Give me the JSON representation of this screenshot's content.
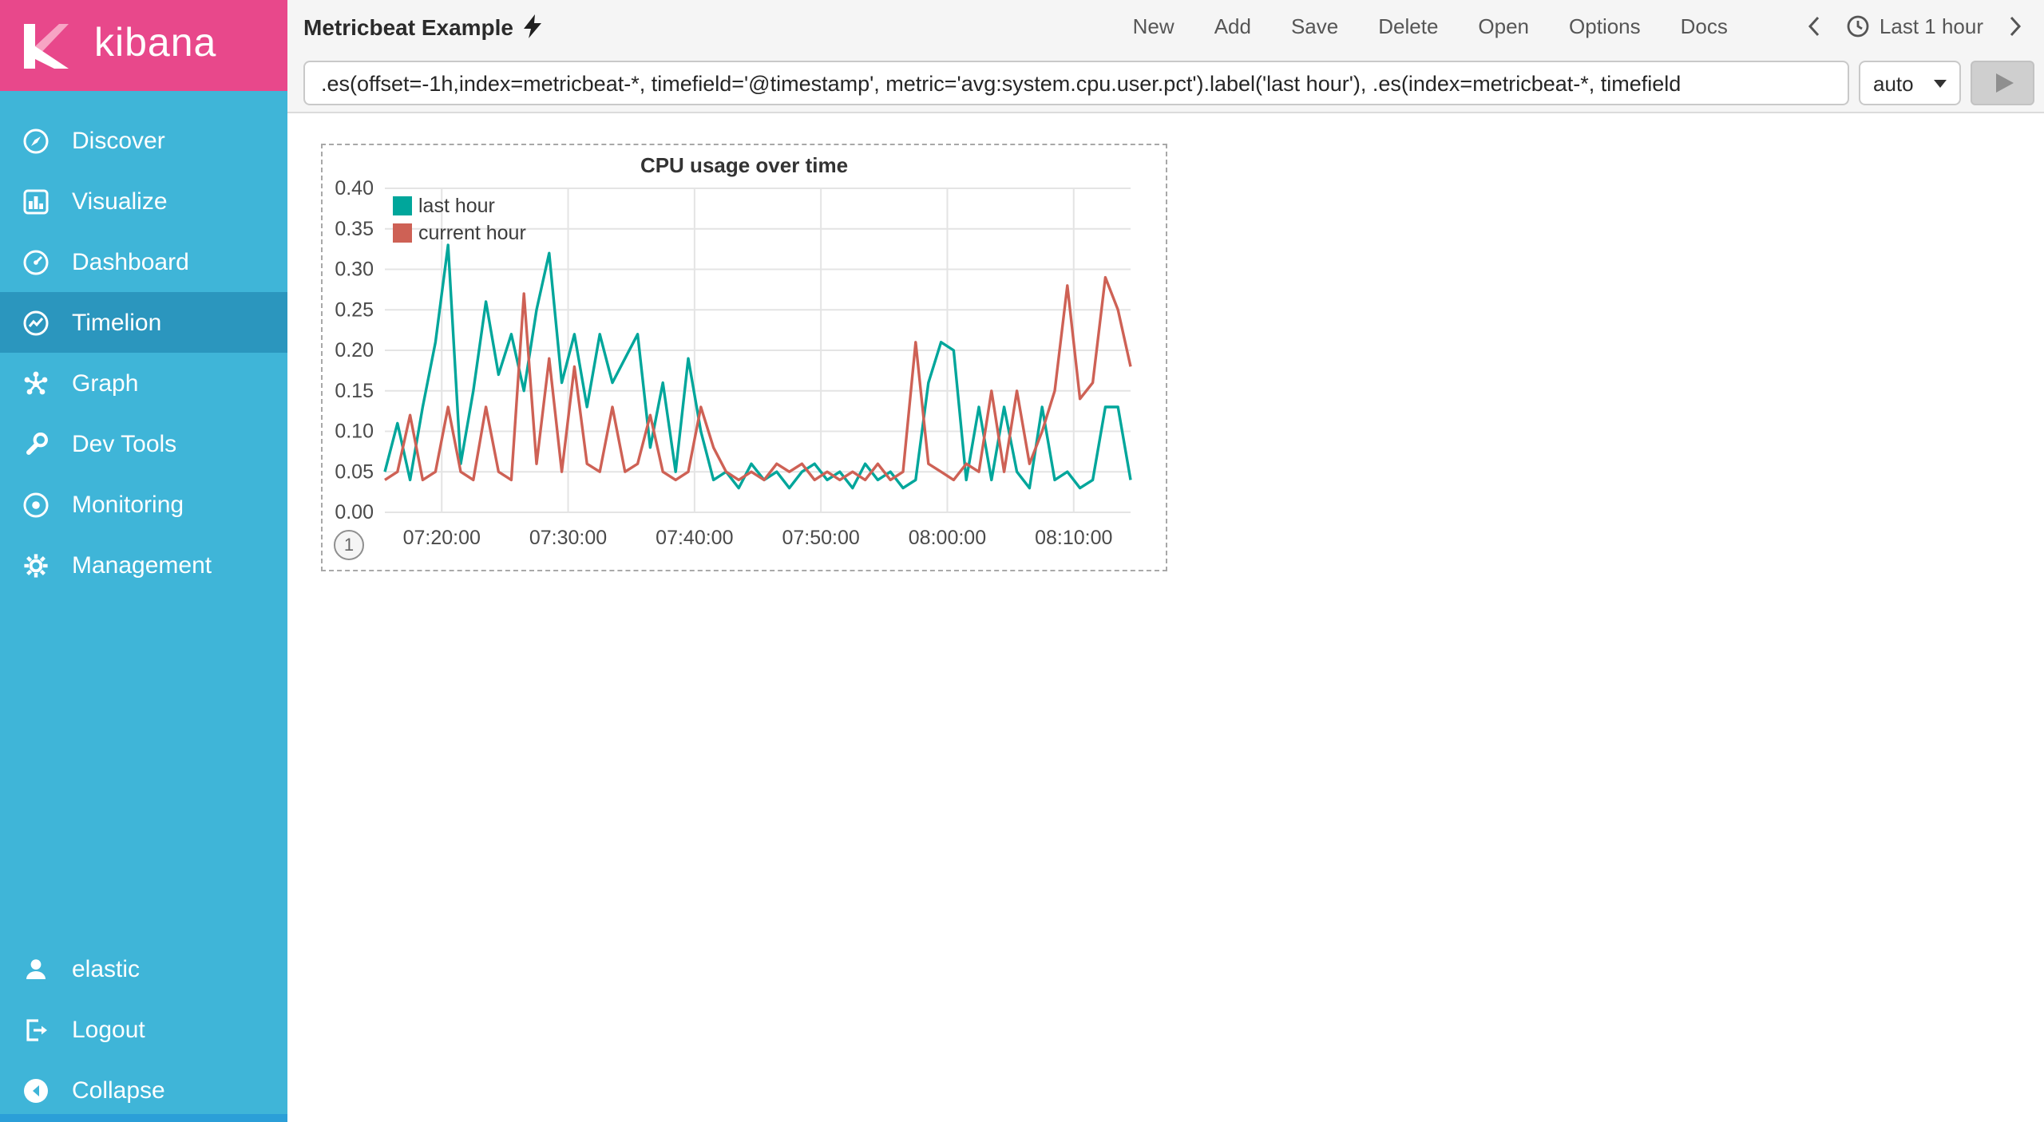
{
  "colors": {
    "sidebar": "#3FB5D8",
    "sidebar_active": "#2B96BE",
    "logo_pink": "#E8488B",
    "series_teal": "#00A69B",
    "series_red": "#CE6155",
    "header_bg": "#F5F5F5"
  },
  "sidebar": {
    "logo_text": "kibana",
    "items": [
      {
        "label": "Discover",
        "icon": "compass-icon"
      },
      {
        "label": "Visualize",
        "icon": "bar-chart-icon"
      },
      {
        "label": "Dashboard",
        "icon": "gauge-icon"
      },
      {
        "label": "Timelion",
        "icon": "timelion-icon",
        "active": true
      },
      {
        "label": "Graph",
        "icon": "graph-network-icon"
      },
      {
        "label": "Dev Tools",
        "icon": "wrench-icon"
      },
      {
        "label": "Monitoring",
        "icon": "eye-icon"
      },
      {
        "label": "Management",
        "icon": "gear-icon"
      }
    ],
    "footer_items": [
      {
        "label": "elastic",
        "icon": "user-icon"
      },
      {
        "label": "Logout",
        "icon": "logout-icon"
      },
      {
        "label": "Collapse",
        "icon": "collapse-circle-icon"
      }
    ]
  },
  "topbar": {
    "title": "Metricbeat Example",
    "title_icon": "lightning-bolt-icon",
    "menu": [
      "New",
      "Add",
      "Save",
      "Delete",
      "Open",
      "Options",
      "Docs"
    ],
    "time_picker": {
      "prev_icon": "chevron-left-icon",
      "clock_icon": "clock-icon",
      "label": "Last 1 hour",
      "next_icon": "chevron-right-icon"
    }
  },
  "query_bar": {
    "expression": ".es(offset=-1h,index=metricbeat-*, timefield='@timestamp', metric='avg:system.cpu.user.pct').label('last hour'), .es(index=metricbeat-*, timefield",
    "interval_value": "auto",
    "play_icon": "play-icon"
  },
  "panel": {
    "badge": "1"
  },
  "chart_data": {
    "type": "line",
    "title": "CPU usage over time",
    "ylim": [
      0,
      0.4
    ],
    "y_tick_step": 0.05,
    "grid": true,
    "legend_position": "top-left",
    "x_start_min": 435.5,
    "x_step_min": 1,
    "x_ticks": [
      {
        "label": "07:20:00",
        "min": 440
      },
      {
        "label": "07:30:00",
        "min": 450
      },
      {
        "label": "07:40:00",
        "min": 460
      },
      {
        "label": "07:50:00",
        "min": 470
      },
      {
        "label": "08:00:00",
        "min": 480
      },
      {
        "label": "08:10:00",
        "min": 490
      }
    ],
    "series": [
      {
        "name": "last hour",
        "color": "#00A69B",
        "values": [
          0.05,
          0.11,
          0.04,
          0.13,
          0.21,
          0.33,
          0.06,
          0.15,
          0.26,
          0.17,
          0.22,
          0.15,
          0.25,
          0.32,
          0.16,
          0.22,
          0.13,
          0.22,
          0.16,
          0.19,
          0.22,
          0.08,
          0.16,
          0.05,
          0.19,
          0.1,
          0.04,
          0.05,
          0.03,
          0.06,
          0.04,
          0.05,
          0.03,
          0.05,
          0.06,
          0.04,
          0.05,
          0.03,
          0.06,
          0.04,
          0.05,
          0.03,
          0.04,
          0.16,
          0.21,
          0.2,
          0.04,
          0.13,
          0.04,
          0.13,
          0.05,
          0.03,
          0.13,
          0.04,
          0.05,
          0.03,
          0.04,
          0.13,
          0.13,
          0.04
        ]
      },
      {
        "name": "current hour",
        "color": "#CE6155",
        "values": [
          0.04,
          0.05,
          0.12,
          0.04,
          0.05,
          0.13,
          0.05,
          0.04,
          0.13,
          0.05,
          0.04,
          0.27,
          0.06,
          0.19,
          0.05,
          0.18,
          0.06,
          0.05,
          0.13,
          0.05,
          0.06,
          0.12,
          0.05,
          0.04,
          0.05,
          0.13,
          0.08,
          0.05,
          0.04,
          0.05,
          0.04,
          0.06,
          0.05,
          0.06,
          0.04,
          0.05,
          0.04,
          0.05,
          0.04,
          0.06,
          0.04,
          0.05,
          0.21,
          0.06,
          0.05,
          0.04,
          0.06,
          0.05,
          0.15,
          0.05,
          0.15,
          0.06,
          0.1,
          0.15,
          0.28,
          0.14,
          0.16,
          0.29,
          0.25,
          0.18
        ]
      }
    ]
  }
}
